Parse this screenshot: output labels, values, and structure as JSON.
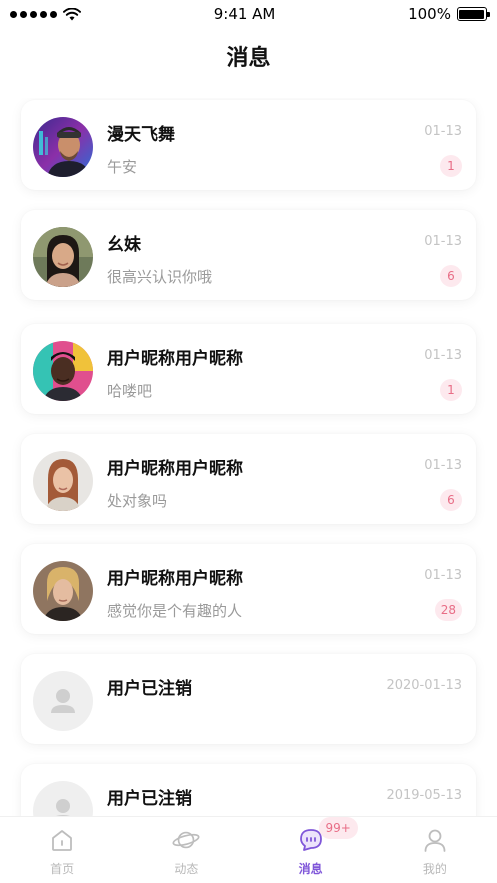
{
  "status_bar": {
    "time": "9:41 AM",
    "battery": "100%"
  },
  "header": {
    "title": "消息"
  },
  "conversations": [
    {
      "name": "漫天飞舞",
      "message": "午安",
      "date": "01-13",
      "unread": "1",
      "avatar": "user-photo"
    },
    {
      "name": "幺妹",
      "message": "很高兴认识你哦",
      "date": "01-13",
      "unread": "6",
      "avatar": "user-photo"
    },
    {
      "name": "用户昵称用户昵称",
      "message": "哈喽吧",
      "date": "01-13",
      "unread": "1",
      "avatar": "user-photo"
    },
    {
      "name": "用户昵称用户昵称",
      "message": "处对象吗",
      "date": "01-13",
      "unread": "6",
      "avatar": "user-photo"
    },
    {
      "name": "用户昵称用户昵称",
      "message": "感觉你是个有趣的人",
      "date": "01-13",
      "unread": "28",
      "avatar": "user-photo"
    },
    {
      "name": "用户已注销",
      "message": "",
      "date": "2020-01-13",
      "unread": "",
      "avatar": "default-avatar-icon"
    },
    {
      "name": "用户已注销",
      "message": "",
      "date": "2019-05-13",
      "unread": "",
      "avatar": "default-avatar-icon"
    }
  ],
  "tab_bar": {
    "tabs": [
      {
        "label": "首页",
        "icon": "home-icon",
        "active": false
      },
      {
        "label": "动态",
        "icon": "planet-icon",
        "active": false
      },
      {
        "label": "消息",
        "icon": "chat-bubble-icon",
        "active": true,
        "badge": "99+"
      },
      {
        "label": "我的",
        "icon": "profile-icon",
        "active": false
      }
    ]
  },
  "colors": {
    "accent": "#7f56d9",
    "badge_bg": "#fde9ee",
    "badge_text": "#e86d86",
    "muted_text": "#9a9a9a"
  }
}
